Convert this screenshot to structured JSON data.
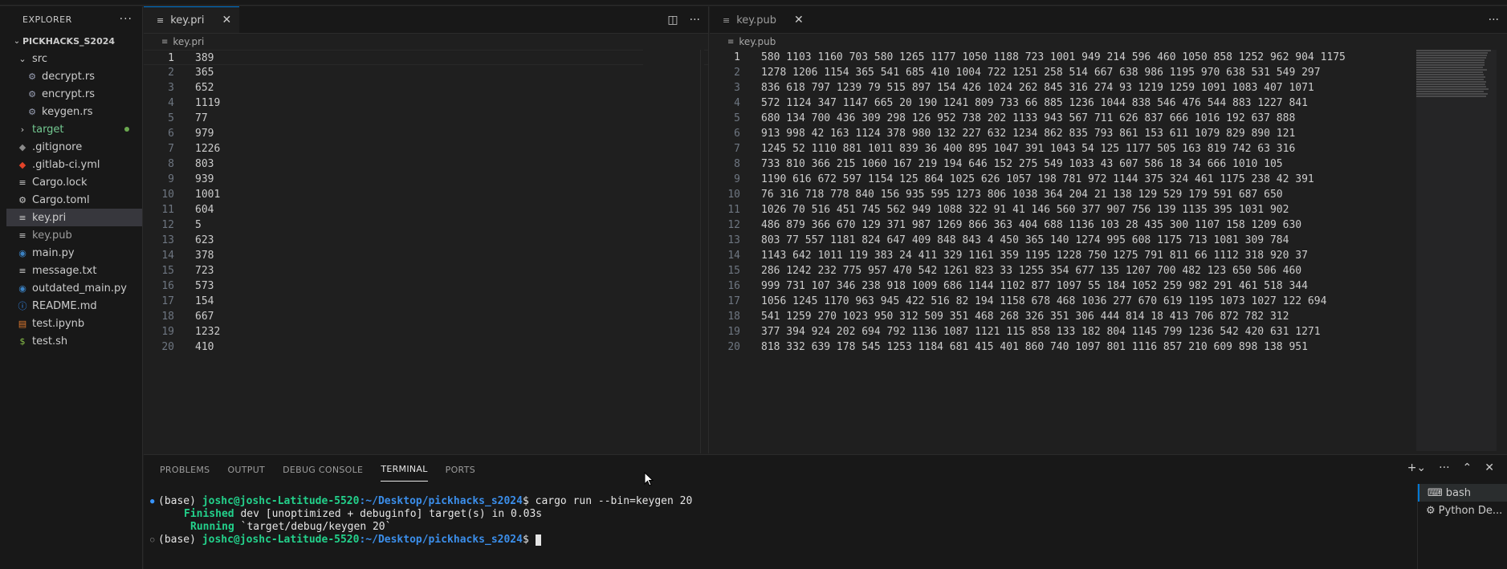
{
  "explorer": {
    "title": "EXPLORER",
    "more": "···",
    "root": "PICKHACKS_S2024",
    "items": [
      {
        "label": "src",
        "kind": "folder-open",
        "indent": 1
      },
      {
        "label": "decrypt.rs",
        "kind": "rust",
        "indent": 2
      },
      {
        "label": "encrypt.rs",
        "kind": "rust",
        "indent": 2
      },
      {
        "label": "keygen.rs",
        "kind": "rust",
        "indent": 2
      },
      {
        "label": "target",
        "kind": "folder",
        "indent": 1
      },
      {
        "label": ".gitignore",
        "kind": "git",
        "indent": 1
      },
      {
        "label": ".gitlab-ci.yml",
        "kind": "gitlab",
        "indent": 1
      },
      {
        "label": "Cargo.lock",
        "kind": "text",
        "indent": 1
      },
      {
        "label": "Cargo.toml",
        "kind": "gear",
        "indent": 1
      },
      {
        "label": "key.pri",
        "kind": "text",
        "indent": 1
      },
      {
        "label": "key.pub",
        "kind": "text",
        "indent": 1
      },
      {
        "label": "main.py",
        "kind": "python",
        "indent": 1
      },
      {
        "label": "message.txt",
        "kind": "text",
        "indent": 1
      },
      {
        "label": "outdated_main.py",
        "kind": "python",
        "indent": 1
      },
      {
        "label": "README.md",
        "kind": "info",
        "indent": 1
      },
      {
        "label": "test.ipynb",
        "kind": "notebook",
        "indent": 1
      },
      {
        "label": "test.sh",
        "kind": "shell",
        "indent": 1
      }
    ]
  },
  "left_editor": {
    "tab": "key.pri",
    "breadcrumb": "key.pri",
    "lines": [
      "389",
      "365",
      "652",
      "1119",
      "77",
      "979",
      "1226",
      "803",
      "939",
      "1001",
      "604",
      "5",
      "623",
      "378",
      "723",
      "573",
      "154",
      "667",
      "1232",
      "410"
    ]
  },
  "right_editor": {
    "tab": "key.pub",
    "breadcrumb": "key.pub",
    "lines": [
      "580 1103 1160 703 580 1265 1177 1050 1188 723 1001 949 214 596 460 1050 858 1252 962 904 1175",
      "1278 1206 1154 365 541 685 410 1004 722 1251 258 514 667 638 986 1195 970 638 531 549 297",
      "836 618 797 1239 79 515 897 154 426 1024 262 845 316 274 93 1219 1259 1091 1083 407 1071",
      "572 1124 347 1147 665 20 190 1241 809 733 66 885 1236 1044 838 546 476 544 883 1227 841",
      "680 134 700 436 309 298 126 952 738 202 1133 943 567 711 626 837 666 1016 192 637 888",
      "913 998 42 163 1124 378 980 132 227 632 1234 862 835 793 861 153 611 1079 829 890 121",
      "1245 52 1110 881 1011 839 36 400 895 1047 391 1043 54 125 1177 505 163 819 742 63 316",
      "733 810 366 215 1060 167 219 194 646 152 275 549 1033 43 607 586 18 34 666 1010 105",
      "1190 616 672 597 1154 125 864 1025 626 1057 198 781 972 1144 375 324 461 1175 238 42 391",
      "76 316 718 778 840 156 935 595 1273 806 1038 364 204 21 138 129 529 179 591 687 650",
      "1026 70 516 451 745 562 949 1088 322 91 41 146 560 377 907 756 139 1135 395 1031 902",
      "486 879 366 670 129 371 987 1269 866 363 404 688 1136 103 28 435 300 1107 158 1209 630",
      "803 77 557 1181 824 647 409 848 843 4 450 365 140 1274 995 608 1175 713 1081 309 784",
      "1143 642 1011 119 383 24 411 329 1161 359 1195 1228 750 1275 791 811 66 1112 318 920 37",
      "286 1242 232 775 957 470 542 1261 823 33 1255 354 677 135 1207 700 482 123 650 506 460",
      "999 731 107 346 238 918 1009 686 1144 1102 877 1097 55 184 1052 259 982 291 461 518 344",
      "1056 1245 1170 963 945 422 516 82 194 1158 678 468 1036 277 670 619 1195 1073 1027 122 694",
      "541 1259 270 1023 950 312 509 351 468 268 326 351 306 444 814 18 413 706 872 782 312",
      "377 394 924 202 694 792 1136 1087 1121 115 858 133 182 804 1145 799 1236 542 420 631 1271",
      "818 332 639 178 545 1253 1184 681 415 401 860 740 1097 801 1116 857 210 609 898 138 951"
    ]
  },
  "panel": {
    "tabs": [
      "PROBLEMS",
      "OUTPUT",
      "DEBUG CONSOLE",
      "TERMINAL",
      "PORTS"
    ],
    "active_tab": "TERMINAL",
    "terminal": {
      "env": "(base)",
      "userhost": "joshc@joshc-Latitude-5520",
      "path": ":~/Desktop/pickhacks_s2024",
      "prompt_symbol": "$",
      "command": " cargo run --bin=keygen 20",
      "out1_keyword": "Finished",
      "out1_rest": " dev [unoptimized + debuginfo] target(s) in 0.03s",
      "out2_keyword": "Running",
      "out2_rest": " `target/debug/keygen 20`"
    },
    "terminals": [
      "bash",
      "Python De..."
    ]
  }
}
